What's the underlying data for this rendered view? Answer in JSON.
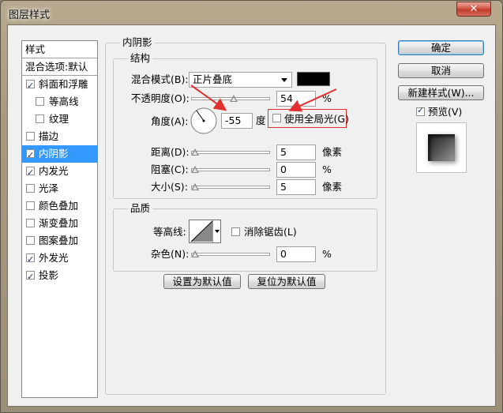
{
  "window": {
    "title": "图层样式",
    "close_glyph": "✕"
  },
  "styles_list": {
    "header": "样式",
    "items": [
      {
        "label": "混合选项:默认",
        "checkbox": false,
        "checked": false,
        "indent": false,
        "selected": false
      },
      {
        "label": "斜面和浮雕",
        "checkbox": true,
        "checked": true,
        "indent": false,
        "selected": false
      },
      {
        "label": "等高线",
        "checkbox": true,
        "checked": false,
        "indent": true,
        "selected": false
      },
      {
        "label": "纹理",
        "checkbox": true,
        "checked": false,
        "indent": true,
        "selected": false
      },
      {
        "label": "描边",
        "checkbox": true,
        "checked": false,
        "indent": false,
        "selected": false
      },
      {
        "label": "内阴影",
        "checkbox": true,
        "checked": true,
        "indent": false,
        "selected": true
      },
      {
        "label": "内发光",
        "checkbox": true,
        "checked": true,
        "indent": false,
        "selected": false
      },
      {
        "label": "光泽",
        "checkbox": true,
        "checked": false,
        "indent": false,
        "selected": false
      },
      {
        "label": "颜色叠加",
        "checkbox": true,
        "checked": false,
        "indent": false,
        "selected": false
      },
      {
        "label": "渐变叠加",
        "checkbox": true,
        "checked": false,
        "indent": false,
        "selected": false
      },
      {
        "label": "图案叠加",
        "checkbox": true,
        "checked": false,
        "indent": false,
        "selected": false
      },
      {
        "label": "外发光",
        "checkbox": true,
        "checked": true,
        "indent": false,
        "selected": false
      },
      {
        "label": "投影",
        "checkbox": true,
        "checked": true,
        "indent": false,
        "selected": false
      }
    ]
  },
  "inner_shadow": {
    "panel_title": "内阴影",
    "structure": {
      "title": "结构",
      "blend_mode_label": "混合模式(B):",
      "blend_mode_value": "正片叠底",
      "color": "#000000",
      "opacity_label": "不透明度(O):",
      "opacity_value": "54",
      "opacity_unit": "%",
      "angle_label": "角度(A):",
      "angle_value": "-55",
      "angle_unit": "度",
      "global_light_label": "使用全局光(G)",
      "global_light_checked": false,
      "distance_label": "距离(D):",
      "distance_value": "5",
      "distance_unit": "像素",
      "choke_label": "阻塞(C):",
      "choke_value": "0",
      "choke_unit": "%",
      "size_label": "大小(S):",
      "size_value": "5",
      "size_unit": "像素"
    },
    "quality": {
      "title": "品质",
      "contour_label": "等高线:",
      "anti_alias_label": "消除锯齿(L)",
      "anti_alias_checked": false,
      "noise_label": "杂色(N):",
      "noise_value": "0",
      "noise_unit": "%"
    },
    "make_default": "设置为默认值",
    "reset_default": "复位为默认值"
  },
  "actions": {
    "ok": "确定",
    "cancel": "取消",
    "new_style": "新建样式(W)...",
    "preview_label": "预览(V)",
    "preview_checked": true
  },
  "annotation_color": "#e03030"
}
